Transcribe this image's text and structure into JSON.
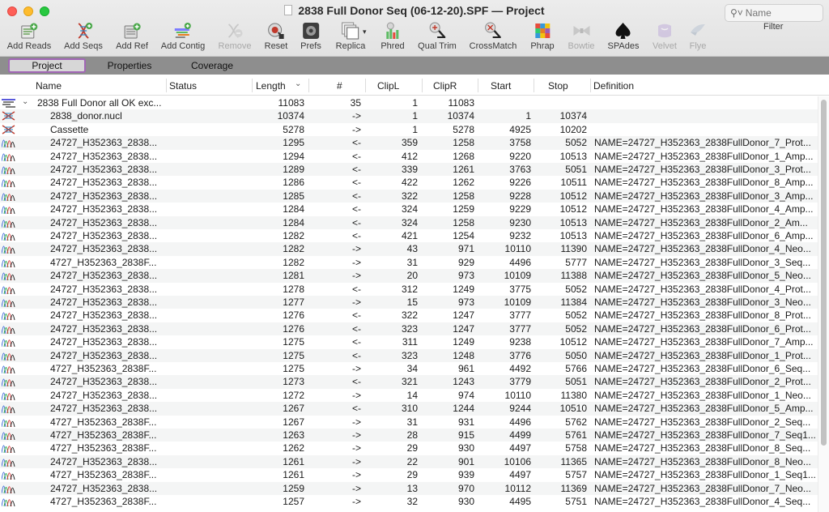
{
  "window": {
    "title": "2838 Full Donor Seq (06-12-20).SPF — Project"
  },
  "toolbar": {
    "buttons": [
      {
        "label": "Add Reads",
        "icon": "add-reads-icon",
        "enabled": true
      },
      {
        "label": "Add Seqs",
        "icon": "add-seqs-icon",
        "enabled": true
      },
      {
        "label": "Add Ref",
        "icon": "add-ref-icon",
        "enabled": true
      },
      {
        "label": "Add Contig",
        "icon": "add-contig-icon",
        "enabled": true
      },
      {
        "label": "Remove",
        "icon": "remove-icon",
        "enabled": false
      },
      {
        "label": "Reset",
        "icon": "reset-icon",
        "enabled": true
      },
      {
        "label": "Prefs",
        "icon": "prefs-icon",
        "enabled": true
      },
      {
        "label": "Replica",
        "icon": "replica-icon",
        "enabled": true
      },
      {
        "label": "Phred",
        "icon": "phred-icon",
        "enabled": true
      },
      {
        "label": "Qual Trim",
        "icon": "qual-trim-icon",
        "enabled": true
      },
      {
        "label": "CrossMatch",
        "icon": "crossmatch-icon",
        "enabled": true
      },
      {
        "label": "Phrap",
        "icon": "phrap-icon",
        "enabled": true
      },
      {
        "label": "Bowtie",
        "icon": "bowtie-icon",
        "enabled": false
      },
      {
        "label": "SPAdes",
        "icon": "spades-icon",
        "enabled": true
      },
      {
        "label": "Velvet",
        "icon": "velvet-icon",
        "enabled": false
      },
      {
        "label": "Flye",
        "icon": "flye-icon",
        "enabled": false
      }
    ],
    "search": {
      "placeholder": "Name",
      "value": ""
    },
    "filter_label": "Filter"
  },
  "tabs": [
    {
      "label": "Project",
      "active": true
    },
    {
      "label": "Properties",
      "active": false
    },
    {
      "label": "Coverage",
      "active": false
    }
  ],
  "columns": [
    "Name",
    "Status",
    "Length",
    "#",
    "ClipL",
    "ClipR",
    "Start",
    "Stop",
    "Definition"
  ],
  "sort_indicator": "chevron-down-icon",
  "rows": [
    {
      "icon": "contig-icon",
      "name": "2838 Full Donor all OK exc...",
      "length": "11083",
      "num": "35",
      "clipl": "1",
      "clipr": "11083",
      "start": "",
      "stop": "",
      "definition": "",
      "expandable": true
    },
    {
      "icon": "sequence-icon",
      "name": "2838_donor.nucl",
      "length": "10374",
      "num": "->",
      "clipl": "1",
      "clipr": "10374",
      "start": "1",
      "stop": "10374",
      "definition": ""
    },
    {
      "icon": "sequence-icon",
      "name": "Cassette",
      "length": "5278",
      "num": "->",
      "clipl": "1",
      "clipr": "5278",
      "start": "4925",
      "stop": "10202",
      "definition": ""
    },
    {
      "icon": "chromatogram-icon",
      "name": "24727_H352363_2838...",
      "length": "1295",
      "num": "<-",
      "clipl": "359",
      "clipr": "1258",
      "start": "3758",
      "stop": "5052",
      "definition": "NAME=24727_H352363_2838FullDonor_7_Prot..."
    },
    {
      "icon": "chromatogram-icon",
      "name": "24727_H352363_2838...",
      "length": "1294",
      "num": "<-",
      "clipl": "412",
      "clipr": "1268",
      "start": "9220",
      "stop": "10513",
      "definition": "NAME=24727_H352363_2838FullDonor_1_Amp..."
    },
    {
      "icon": "chromatogram-icon",
      "name": "24727_H352363_2838...",
      "length": "1289",
      "num": "<-",
      "clipl": "339",
      "clipr": "1261",
      "start": "3763",
      "stop": "5051",
      "definition": "NAME=24727_H352363_2838FullDonor_3_Prot..."
    },
    {
      "icon": "chromatogram-icon",
      "name": "24727_H352363_2838...",
      "length": "1286",
      "num": "<-",
      "clipl": "422",
      "clipr": "1262",
      "start": "9226",
      "stop": "10511",
      "definition": "NAME=24727_H352363_2838FullDonor_8_Amp..."
    },
    {
      "icon": "chromatogram-icon",
      "name": "24727_H352363_2838...",
      "length": "1285",
      "num": "<-",
      "clipl": "322",
      "clipr": "1258",
      "start": "9228",
      "stop": "10512",
      "definition": "NAME=24727_H352363_2838FullDonor_3_Amp..."
    },
    {
      "icon": "chromatogram-icon",
      "name": "24727_H352363_2838...",
      "length": "1284",
      "num": "<-",
      "clipl": "324",
      "clipr": "1259",
      "start": "9229",
      "stop": "10512",
      "definition": "NAME=24727_H352363_2838FullDonor_4_Amp..."
    },
    {
      "icon": "chromatogram-icon",
      "name": "24727_H352363_2838...",
      "length": "1284",
      "num": "<-",
      "clipl": "324",
      "clipr": "1258",
      "start": "9230",
      "stop": "10513",
      "definition": "NAME=24727_H352363_2838FullDonor_2_Am..."
    },
    {
      "icon": "chromatogram-icon",
      "name": "24727_H352363_2838...",
      "length": "1282",
      "num": "<-",
      "clipl": "421",
      "clipr": "1254",
      "start": "9232",
      "stop": "10513",
      "definition": "NAME=24727_H352363_2838FullDonor_6_Amp..."
    },
    {
      "icon": "chromatogram-icon",
      "name": "24727_H352363_2838...",
      "length": "1282",
      "num": "->",
      "clipl": "43",
      "clipr": "971",
      "start": "10110",
      "stop": "11390",
      "definition": "NAME=24727_H352363_2838FullDonor_4_Neo..."
    },
    {
      "icon": "chromatogram-icon",
      "name": "4727_H352363_2838F...",
      "length": "1282",
      "num": "->",
      "clipl": "31",
      "clipr": "929",
      "start": "4496",
      "stop": "5777",
      "definition": "NAME=24727_H352363_2838FullDonor_3_Seq..."
    },
    {
      "icon": "chromatogram-icon",
      "name": "24727_H352363_2838...",
      "length": "1281",
      "num": "->",
      "clipl": "20",
      "clipr": "973",
      "start": "10109",
      "stop": "11388",
      "definition": "NAME=24727_H352363_2838FullDonor_5_Neo..."
    },
    {
      "icon": "chromatogram-icon",
      "name": "24727_H352363_2838...",
      "length": "1278",
      "num": "<-",
      "clipl": "312",
      "clipr": "1249",
      "start": "3775",
      "stop": "5052",
      "definition": "NAME=24727_H352363_2838FullDonor_4_Prot..."
    },
    {
      "icon": "chromatogram-icon",
      "name": "24727_H352363_2838...",
      "length": "1277",
      "num": "->",
      "clipl": "15",
      "clipr": "973",
      "start": "10109",
      "stop": "11384",
      "definition": "NAME=24727_H352363_2838FullDonor_3_Neo..."
    },
    {
      "icon": "chromatogram-icon",
      "name": "24727_H352363_2838...",
      "length": "1276",
      "num": "<-",
      "clipl": "322",
      "clipr": "1247",
      "start": "3777",
      "stop": "5052",
      "definition": "NAME=24727_H352363_2838FullDonor_8_Prot..."
    },
    {
      "icon": "chromatogram-icon",
      "name": "24727_H352363_2838...",
      "length": "1276",
      "num": "<-",
      "clipl": "323",
      "clipr": "1247",
      "start": "3777",
      "stop": "5052",
      "definition": "NAME=24727_H352363_2838FullDonor_6_Prot..."
    },
    {
      "icon": "chromatogram-icon",
      "name": "24727_H352363_2838...",
      "length": "1275",
      "num": "<-",
      "clipl": "311",
      "clipr": "1249",
      "start": "9238",
      "stop": "10512",
      "definition": "NAME=24727_H352363_2838FullDonor_7_Amp..."
    },
    {
      "icon": "chromatogram-icon",
      "name": "24727_H352363_2838...",
      "length": "1275",
      "num": "<-",
      "clipl": "323",
      "clipr": "1248",
      "start": "3776",
      "stop": "5050",
      "definition": "NAME=24727_H352363_2838FullDonor_1_Prot..."
    },
    {
      "icon": "chromatogram-icon",
      "name": "4727_H352363_2838F...",
      "length": "1275",
      "num": "->",
      "clipl": "34",
      "clipr": "961",
      "start": "4492",
      "stop": "5766",
      "definition": "NAME=24727_H352363_2838FullDonor_6_Seq..."
    },
    {
      "icon": "chromatogram-icon",
      "name": "24727_H352363_2838...",
      "length": "1273",
      "num": "<-",
      "clipl": "321",
      "clipr": "1243",
      "start": "3779",
      "stop": "5051",
      "definition": "NAME=24727_H352363_2838FullDonor_2_Prot..."
    },
    {
      "icon": "chromatogram-icon",
      "name": "24727_H352363_2838...",
      "length": "1272",
      "num": "->",
      "clipl": "14",
      "clipr": "974",
      "start": "10110",
      "stop": "11380",
      "definition": "NAME=24727_H352363_2838FullDonor_1_Neo..."
    },
    {
      "icon": "chromatogram-icon",
      "name": "24727_H352363_2838...",
      "length": "1267",
      "num": "<-",
      "clipl": "310",
      "clipr": "1244",
      "start": "9244",
      "stop": "10510",
      "definition": "NAME=24727_H352363_2838FullDonor_5_Amp..."
    },
    {
      "icon": "chromatogram-icon",
      "name": "4727_H352363_2838F...",
      "length": "1267",
      "num": "->",
      "clipl": "31",
      "clipr": "931",
      "start": "4496",
      "stop": "5762",
      "definition": "NAME=24727_H352363_2838FullDonor_2_Seq..."
    },
    {
      "icon": "chromatogram-icon",
      "name": "4727_H352363_2838F...",
      "length": "1263",
      "num": "->",
      "clipl": "28",
      "clipr": "915",
      "start": "4499",
      "stop": "5761",
      "definition": "NAME=24727_H352363_2838FullDonor_7_Seq1..."
    },
    {
      "icon": "chromatogram-icon",
      "name": "4727_H352363_2838F...",
      "length": "1262",
      "num": "->",
      "clipl": "29",
      "clipr": "930",
      "start": "4497",
      "stop": "5758",
      "definition": "NAME=24727_H352363_2838FullDonor_8_Seq..."
    },
    {
      "icon": "chromatogram-icon",
      "name": "24727_H352363_2838...",
      "length": "1261",
      "num": "->",
      "clipl": "22",
      "clipr": "901",
      "start": "10106",
      "stop": "11365",
      "definition": "NAME=24727_H352363_2838FullDonor_8_Neo..."
    },
    {
      "icon": "chromatogram-icon",
      "name": "4727_H352363_2838F...",
      "length": "1261",
      "num": "->",
      "clipl": "29",
      "clipr": "939",
      "start": "4497",
      "stop": "5757",
      "definition": "NAME=24727_H352363_2838FullDonor_1_Seq1..."
    },
    {
      "icon": "chromatogram-icon",
      "name": "24727_H352363_2838...",
      "length": "1259",
      "num": "->",
      "clipl": "13",
      "clipr": "970",
      "start": "10112",
      "stop": "11369",
      "definition": "NAME=24727_H352363_2838FullDonor_7_Neo..."
    },
    {
      "icon": "chromatogram-icon",
      "name": "4727_H352363_2838F...",
      "length": "1257",
      "num": "->",
      "clipl": "32",
      "clipr": "930",
      "start": "4495",
      "stop": "5751",
      "definition": "NAME=24727_H352363_2838FullDonor_4_Seq..."
    }
  ],
  "colors": {
    "tab_active_border": "#a166b5",
    "tabbar_bg": "#8e8e8e",
    "row_alt": "#f4f5f5"
  }
}
